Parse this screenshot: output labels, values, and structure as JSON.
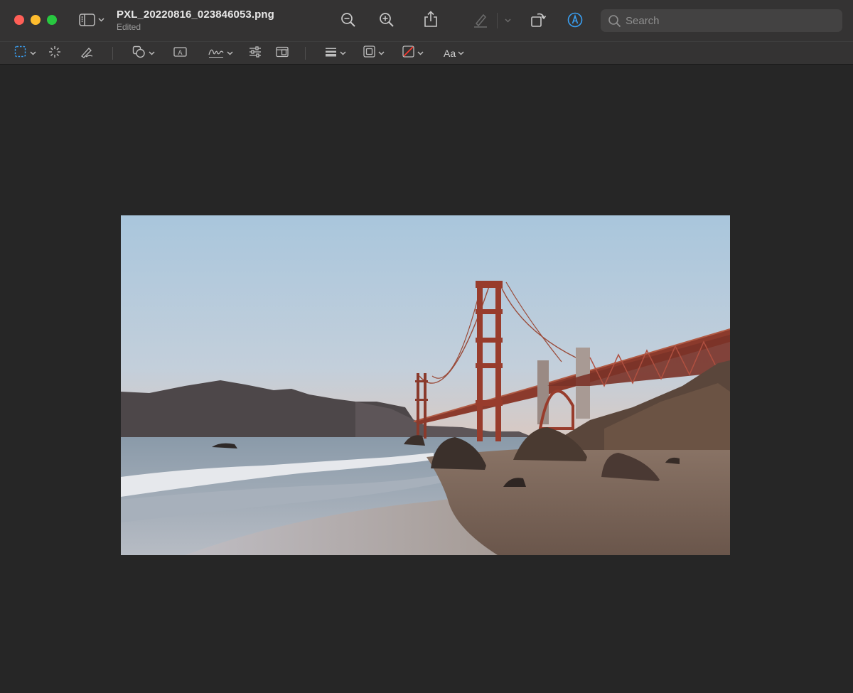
{
  "window": {
    "title": "PXL_20220816_023846053.png",
    "subtitle": "Edited"
  },
  "search": {
    "placeholder": "Search"
  },
  "markup": {
    "font_label": "Aa"
  },
  "colors": {
    "close": "#ff5f57",
    "minimize": "#febc2e",
    "zoom": "#28c840",
    "markup_accent": "#3aa0f3",
    "selection_accent": "#3aa0f3"
  },
  "icons": {
    "toolbar": [
      "sidebar-icon",
      "zoom-out-icon",
      "zoom-in-icon",
      "share-icon",
      "highlight-pen-icon",
      "rotate-icon",
      "markup-icon",
      "search-icon"
    ],
    "markup": [
      "rect-selection-icon",
      "instant-alpha-icon",
      "sketch-icon",
      "shapes-icon",
      "text-box-icon",
      "signature-icon",
      "adjust-color-icon",
      "page-size-icon",
      "line-style-icon",
      "border-color-icon",
      "fill-color-icon",
      "text-style-icon"
    ]
  }
}
